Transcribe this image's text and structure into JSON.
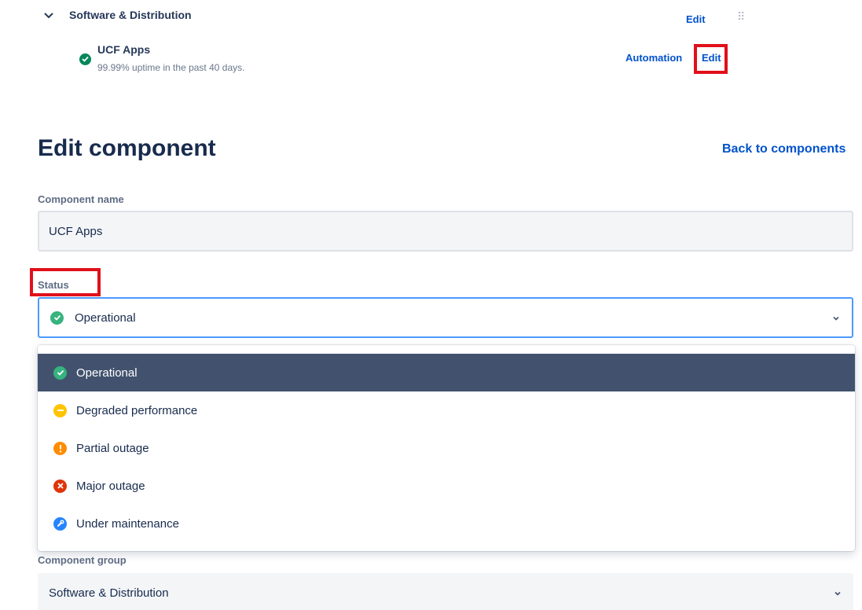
{
  "group": {
    "title": "Software & Distribution",
    "edit_label": "Edit",
    "drag_handle": "⠿"
  },
  "component_row": {
    "name": "UCF Apps",
    "uptime": "99.99% uptime in the past 40 days.",
    "automation_label": "Automation",
    "edit_label": "Edit",
    "status_icon": "check-circle-icon",
    "status_color": "#00875a"
  },
  "form": {
    "heading": "Edit component",
    "back_label": "Back to components",
    "name_label": "Component name",
    "name_value": "UCF Apps",
    "status_label": "Status",
    "status_selected": "Operational",
    "group_label": "Component group",
    "group_value": "Software & Distribution"
  },
  "status_options": [
    {
      "label": "Operational",
      "icon": "check-icon",
      "color": "#36b37e",
      "selected": true
    },
    {
      "label": "Degraded performance",
      "icon": "minus-icon",
      "color": "#ffc400",
      "selected": false
    },
    {
      "label": "Partial outage",
      "icon": "exclamation-icon",
      "color": "#ff8b00",
      "selected": false
    },
    {
      "label": "Major outage",
      "icon": "cross-icon",
      "color": "#de350b",
      "selected": false
    },
    {
      "label": "Under maintenance",
      "icon": "wrench-icon",
      "color": "#2684ff",
      "selected": false
    }
  ],
  "colors": {
    "link": "#0052cc",
    "highlight_box": "#e0101a",
    "selected_option_bg": "#42526e",
    "focus_border": "#4c9aff"
  }
}
